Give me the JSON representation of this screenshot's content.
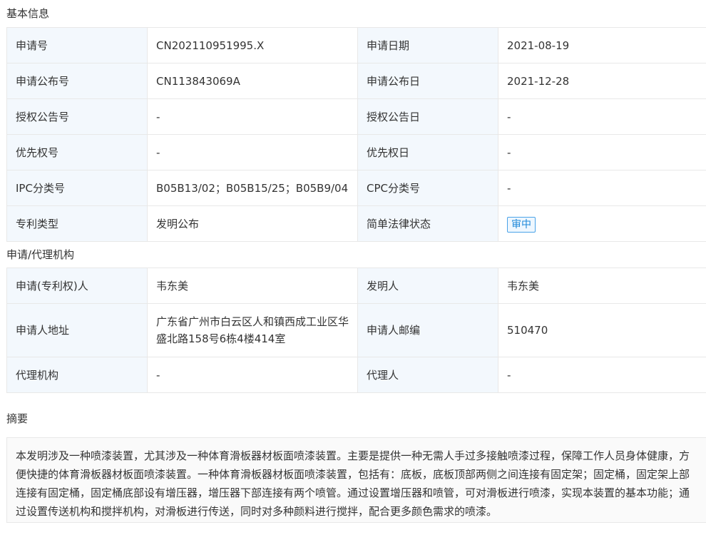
{
  "basic_info": {
    "title": "基本信息",
    "rows": [
      {
        "l1": "申请号",
        "v1": "CN202110951995.X",
        "l2": "申请日期",
        "v2": "2021-08-19"
      },
      {
        "l1": "申请公布号",
        "v1": "CN113843069A",
        "l2": "申请公布日",
        "v2": "2021-12-28"
      },
      {
        "l1": "授权公告号",
        "v1": "-",
        "l2": "授权公告日",
        "v2": "-"
      },
      {
        "l1": "优先权号",
        "v1": "-",
        "l2": "优先权日",
        "v2": "-"
      },
      {
        "l1": "IPC分类号",
        "v1": "B05B13/02；B05B15/25；B05B9/04",
        "l2": "CPC分类号",
        "v2": "-"
      },
      {
        "l1": "专利类型",
        "v1": "发明公布",
        "l2": "简单法律状态",
        "v2": "审中"
      }
    ]
  },
  "agency_info": {
    "title": "申请/代理机构",
    "rows": [
      {
        "l1": "申请(专利权)人",
        "v1": "韦东美",
        "l2": "发明人",
        "v2": "韦东美"
      },
      {
        "l1": "申请人地址",
        "v1": "广东省广州市白云区人和镇西成工业区华盛北路158号6栋4楼414室",
        "l2": "申请人邮编",
        "v2": "510470"
      },
      {
        "l1": "代理机构",
        "v1": "-",
        "l2": "代理人",
        "v2": "-"
      }
    ]
  },
  "abstract": {
    "title": "摘要",
    "text": "本发明涉及一种喷漆装置，尤其涉及一种体育滑板器材板面喷漆装置。主要是提供一种无需人手过多接触喷漆过程，保障工作人员身体健康，方便快捷的体育滑板器材板面喷漆装置。一种体育滑板器材板面喷漆装置，包括有：底板，底板顶部两侧之间连接有固定架；固定桶，固定架上部连接有固定桶，固定桶底部设有增压器，增压器下部连接有两个喷管。通过设置增压器和喷管，可对滑板进行喷漆，实现本装置的基本功能；通过设置传送机构和搅拌机构，对滑板进行传送，同时对多种颜料进行搅拌，配合更多颜色需求的喷漆。"
  },
  "colors": {
    "label_bg": "#f3f8fd",
    "border": "#e8e8e8",
    "status_accent": "#1e88d9"
  }
}
